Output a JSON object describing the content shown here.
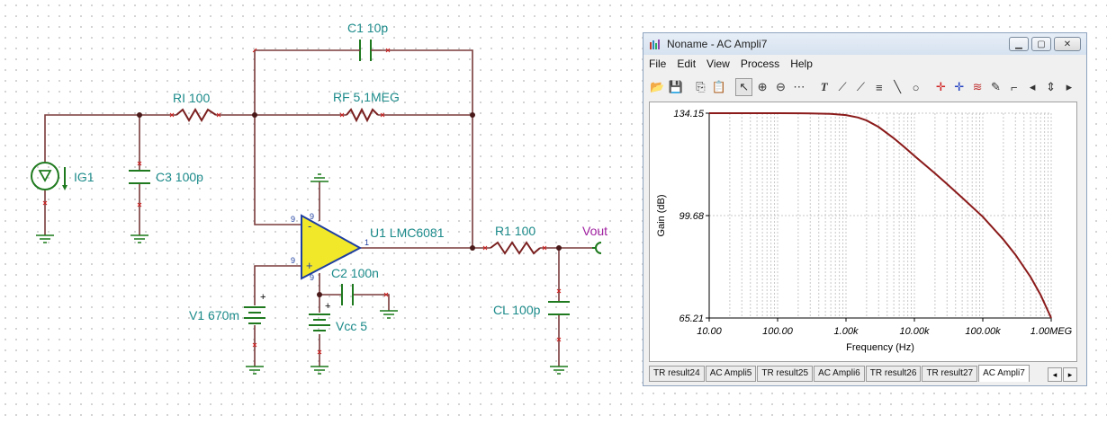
{
  "schematic": {
    "c1_label": "C1 10p",
    "rf_label": "RF 5,1MEG",
    "ri_label": "RI 100",
    "c3_label": "C3 100p",
    "ig1_label": "IG1",
    "u1_label": "U1 LMC6081",
    "r1_label": "R1 100",
    "vout_label": "Vout",
    "cl_label": "CL 100p",
    "v1_label": "V1 670m",
    "c2_label": "C2 100n",
    "vcc_label": "Vcc 5",
    "pin_a": "9",
    "pin_b": "9",
    "pin_c": "9",
    "pin_d": "9",
    "pin_e": "9",
    "pin_f": "1",
    "plus": "+",
    "minus": "-"
  },
  "window": {
    "title": "Noname - AC Ampli7",
    "menu": [
      "File",
      "Edit",
      "View",
      "Process",
      "Help"
    ],
    "min_label": "▁",
    "max_label": "▢",
    "close_label": "✕"
  },
  "toolbar": {
    "icons": [
      "open-icon",
      "save-icon",
      "copy-icon",
      "paste-icon",
      "pointer-icon",
      "zoom-in-icon",
      "zoom-out-icon",
      "grid-icon",
      "text-icon",
      "cursor-a-icon",
      "cursor-b-icon",
      "hatch-icon",
      "line-icon",
      "circle-icon",
      "marker-a-icon",
      "marker-b-icon",
      "add-trace-icon",
      "probe-icon",
      "angle-icon",
      "left-icon",
      "updown-icon",
      "right-icon"
    ],
    "glyphs": [
      "📂",
      "💾",
      "⎘",
      "📋",
      "↖",
      "⊕",
      "⊖",
      "⋯",
      "T",
      "⟋",
      "⟋",
      "≡",
      "╲",
      "○",
      "✛",
      "✛",
      "≋",
      "✎",
      "⌐",
      "◂",
      "⇕",
      "▸"
    ]
  },
  "chart_data": {
    "type": "line",
    "xlabel": "Frequency (Hz)",
    "ylabel": "Gain (dB)",
    "xscale": "log",
    "xlim": [
      10,
      1000000
    ],
    "ylim": [
      65.21,
      134.15
    ],
    "xticks": [
      "10.00",
      "100.00",
      "1.00k",
      "10.00k",
      "100.00k",
      "1.00MEG"
    ],
    "yticks": [
      "134.15",
      "99.68",
      "65.21"
    ],
    "grid": true,
    "line_color": "#8b1a1a",
    "series": [
      {
        "x": [
          10,
          100,
          300,
          600,
          1000,
          1500,
          2000,
          3000,
          5000,
          7000,
          10000,
          20000,
          30000,
          50000,
          100000,
          200000,
          300000,
          500000,
          700000,
          1000000
        ],
        "y": [
          134.15,
          134.15,
          134.1,
          133.95,
          133.5,
          132.7,
          131.7,
          129.5,
          125.7,
          122.9,
          119.8,
          113.9,
          110.3,
          105.7,
          99.3,
          91.6,
          86.5,
          79.0,
          73.0,
          65.21
        ]
      }
    ]
  },
  "tabs": [
    "TR result24",
    "AC Ampli5",
    "TR result25",
    "AC Ampli6",
    "TR result26",
    "TR result27",
    "AC Ampli7"
  ],
  "active_tab": "AC Ampli7",
  "tabnav": {
    "left": "◂",
    "right": "▸"
  }
}
